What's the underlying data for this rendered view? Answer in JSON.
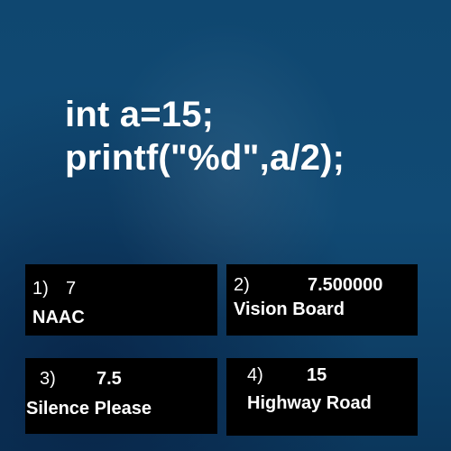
{
  "code": {
    "line1": "int a=15;",
    "line2": "printf(\"%d\",a/2);"
  },
  "options": [
    {
      "number": "1)",
      "value": "7",
      "label": "NAAC"
    },
    {
      "number": "2)",
      "value": "7.500000",
      "label": "Vision Board"
    },
    {
      "number": "3)",
      "value": "7.5",
      "label": "Silence Please"
    },
    {
      "number": "4)",
      "value": "15",
      "label": "Highway Road"
    }
  ],
  "colors": {
    "background": "#114a74",
    "card": "#000000",
    "text": "#ffffff"
  }
}
